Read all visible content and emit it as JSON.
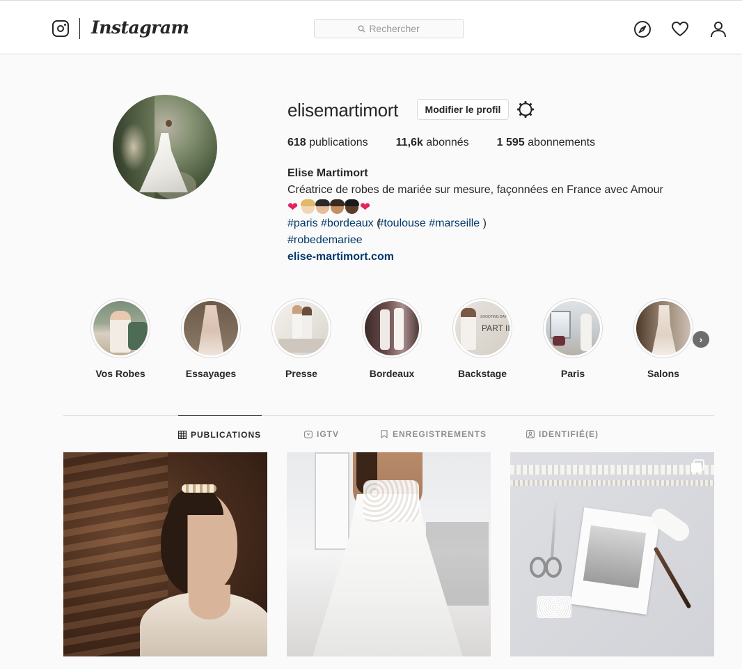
{
  "nav": {
    "wordmark": "Instagram",
    "search_placeholder": "Rechercher"
  },
  "profile": {
    "username": "elisemartimort",
    "edit_button": "Modifier le profil",
    "stats": [
      {
        "value": "618",
        "label": "publications"
      },
      {
        "value": "11,6k",
        "label": "abonnés"
      },
      {
        "value": "1 595",
        "label": "abonnements"
      }
    ],
    "full_name": "Elise Martimort",
    "bio_line": "Créatrice de robes de mariée sur mesure, façonnées en France avec Amour",
    "emoji_line": [
      "red-heart",
      "woman-light-skin",
      "woman-medium-light-skin",
      "woman-medium-skin",
      "woman-dark-skin",
      "red-heart"
    ],
    "hashtags": {
      "paris": "#paris",
      "bordeaux": "#bordeaux",
      "paren_open": "(",
      "toulouse": "#toulouse",
      "marseille": "#marseille",
      "paren_close": ")",
      "robedemariee": "#robedemariee"
    },
    "website": "elise-martimort.com"
  },
  "highlights": [
    {
      "label": "Vos Robes"
    },
    {
      "label": "Essayages"
    },
    {
      "label": "Presse"
    },
    {
      "label": "Bordeaux"
    },
    {
      "label": "Backstage",
      "overlay_text_1": "SHOOTING DAY",
      "overlay_text_2": "PART II"
    },
    {
      "label": "Paris"
    },
    {
      "label": "Salons"
    }
  ],
  "tabs": [
    {
      "label": "PUBLICATIONS",
      "icon": "grid-icon",
      "active": true
    },
    {
      "label": "IGTV",
      "icon": "igtv-icon",
      "active": false
    },
    {
      "label": "ENREGISTREMENTS",
      "icon": "bookmark-icon",
      "active": false
    },
    {
      "label": "IDENTIFIÉ(E)",
      "icon": "tagged-icon",
      "active": false
    }
  ],
  "posts": [
    {
      "description": "bride-portrait"
    },
    {
      "description": "backless-dress"
    },
    {
      "description": "sewing-flatlay",
      "badge": "multiple-images-icon"
    }
  ]
}
